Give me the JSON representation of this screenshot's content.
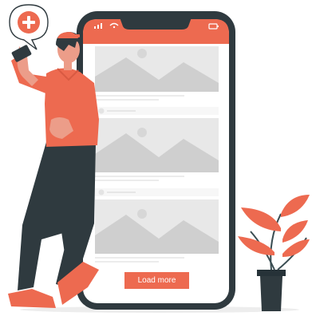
{
  "feed": {
    "load_more_label": "Load more"
  },
  "colors": {
    "accent": "#ed6a50",
    "phone_body": "#2f3a3f",
    "screen": "#ffffff",
    "placeholder": "#e6e6e6",
    "placeholder_shape": "#c9c9c9"
  },
  "icons": {
    "bubble": "plus-icon",
    "status_bar": [
      "signal-icon",
      "wifi-icon",
      "battery-icon"
    ]
  }
}
